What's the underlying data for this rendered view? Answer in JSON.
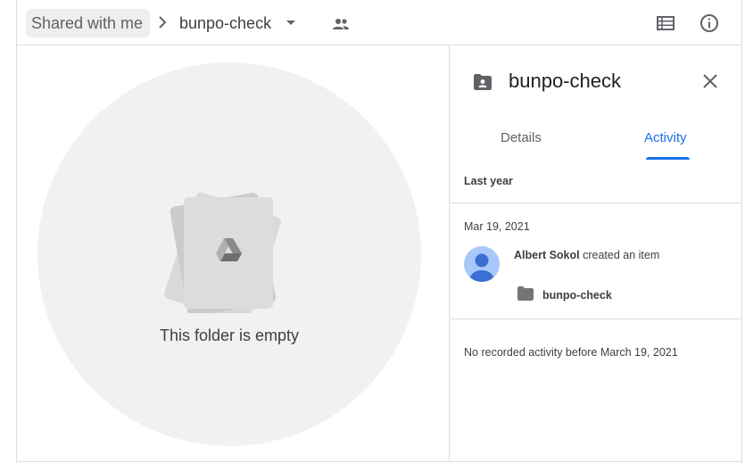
{
  "header": {
    "breadcrumb_root": "Shared with me",
    "breadcrumb_current": "bunpo-check",
    "icons": [
      "chevron-right-icon",
      "dropdown-caret-icon",
      "shared-people-icon",
      "list-view-icon",
      "info-icon"
    ]
  },
  "main": {
    "empty_message": "This folder is empty"
  },
  "panel": {
    "title": "bunpo-check",
    "tabs": [
      {
        "label": "Details",
        "active": false
      },
      {
        "label": "Activity",
        "active": true
      }
    ],
    "section_label": "Last year",
    "activity": {
      "date": "Mar 19, 2021",
      "user": "Albert Sokol",
      "action": "created an item",
      "item_name": "bunpo-check",
      "item_icon": "folder-icon"
    },
    "no_activity_text": "No recorded activity before March 19, 2021"
  },
  "colors": {
    "accent": "#1a73e8",
    "divider": "#dadce0",
    "empty_bg": "#f1f1f1",
    "avatar_bg": "#a8c7fa",
    "avatar_fg": "#3b6fd4"
  }
}
